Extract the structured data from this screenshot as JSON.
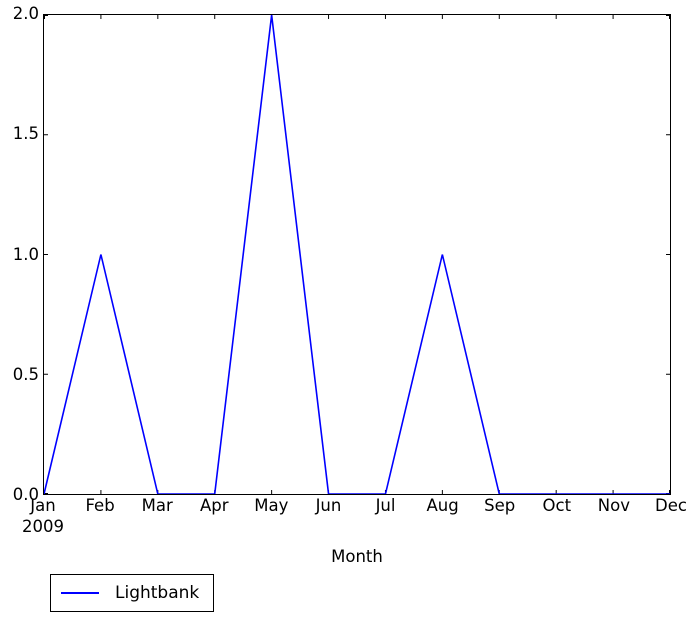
{
  "chart_data": {
    "type": "line",
    "title": "",
    "subtitle": "",
    "xlabel": "Month",
    "ylabel": "",
    "categories": [
      "Jan",
      "Feb",
      "Mar",
      "Apr",
      "May",
      "Jun",
      "Jul",
      "Aug",
      "Sep",
      "Oct",
      "Nov",
      "Dec"
    ],
    "x_sublabels": [
      "2009",
      "",
      "",
      "",
      "",
      "",
      "",
      "",
      "",
      "",
      "",
      ""
    ],
    "series": [
      {
        "name": "Lightbank",
        "color": "#0000ff",
        "values": [
          0,
          1,
          0,
          0,
          2,
          0,
          0,
          1,
          0,
          0,
          0,
          0
        ]
      }
    ],
    "ylim": [
      0.0,
      2.0
    ],
    "yticks": [
      0.0,
      0.5,
      1.0,
      1.5,
      2.0
    ],
    "ytick_labels": [
      "0.0",
      "0.5",
      "1.0",
      "1.5",
      "2.0"
    ],
    "xlim": [
      0,
      11
    ],
    "grid": false,
    "legend_position": "below-left",
    "legend_entries": [
      {
        "label": "Lightbank",
        "color": "#0000ff",
        "marker": "line"
      }
    ]
  }
}
